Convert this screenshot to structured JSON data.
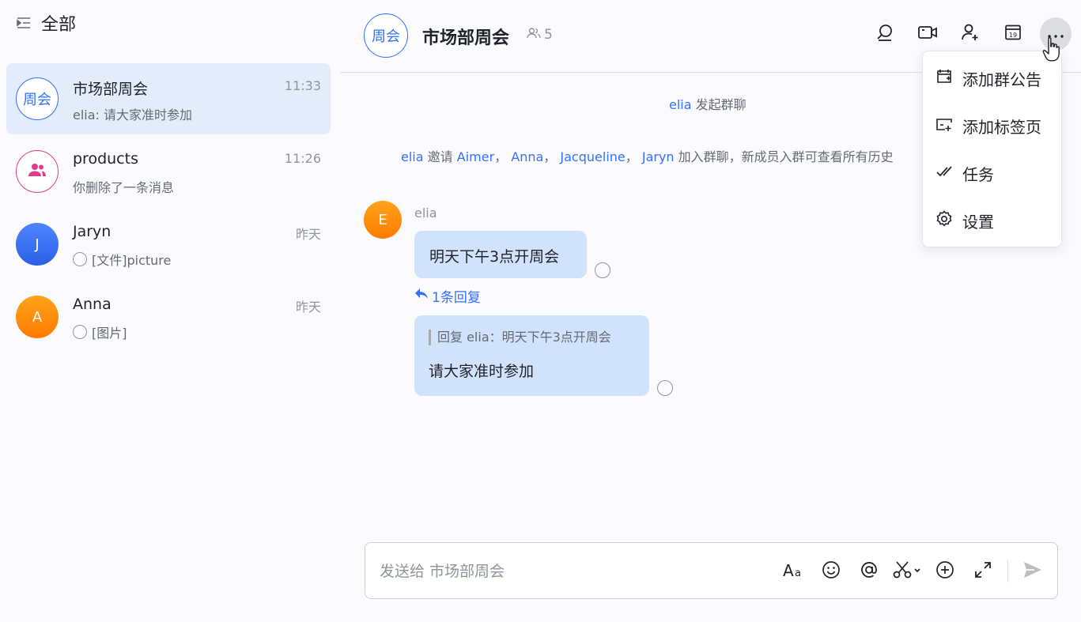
{
  "sidebar": {
    "title": "全部",
    "conversations": [
      {
        "avatar_text": "周会",
        "name": "市场部周会",
        "time": "11:33",
        "preview": "elia: 请大家准时参加",
        "active": true
      },
      {
        "avatar_icon": "group-icon",
        "name": "products",
        "time": "11:26",
        "preview": "你删除了一条消息"
      },
      {
        "avatar_text": "J",
        "name": "Jaryn",
        "time": "昨天",
        "preview": "[文件]picture",
        "avatar_color": "#3370ff"
      },
      {
        "avatar_text": "A",
        "name": "Anna",
        "time": "昨天",
        "preview": "[图片]",
        "avatar_color": "#ff8800"
      }
    ]
  },
  "chat": {
    "avatar_text": "周会",
    "title": "市场部周会",
    "member_count": "5",
    "system_messages": {
      "created": {
        "actor": "elia",
        "text": "发起群聊"
      },
      "invited": {
        "actor": "elia",
        "verb": "邀请",
        "invitees": [
          "Aimer",
          "Anna",
          "Jacqueline",
          "Jaryn"
        ],
        "separator": "，",
        "suffix": "加入群聊，新成员入群可查看所有历史"
      }
    },
    "messages": [
      {
        "sender_initial": "E",
        "sender": "elia",
        "text": "明天下午3点开周会",
        "reply_count_label": "1条回复"
      },
      {
        "quote_label": "回复 elia：明天下午3点开周会",
        "text": "请大家准时参加"
      }
    ],
    "input_placeholder": "发送给 市场部周会"
  },
  "menu": {
    "items": [
      {
        "label": "添加群公告",
        "icon": "announcement-icon"
      },
      {
        "label": "添加标签页",
        "icon": "tab-add-icon"
      },
      {
        "label": "任务",
        "icon": "task-check-icon"
      },
      {
        "label": "设置",
        "icon": "settings-gear-icon"
      }
    ]
  },
  "colors": {
    "accent": "#3370ff",
    "bubble": "#d1e2fd",
    "active_row": "#e3ecfa",
    "products_avatar": "#e33a8a"
  }
}
